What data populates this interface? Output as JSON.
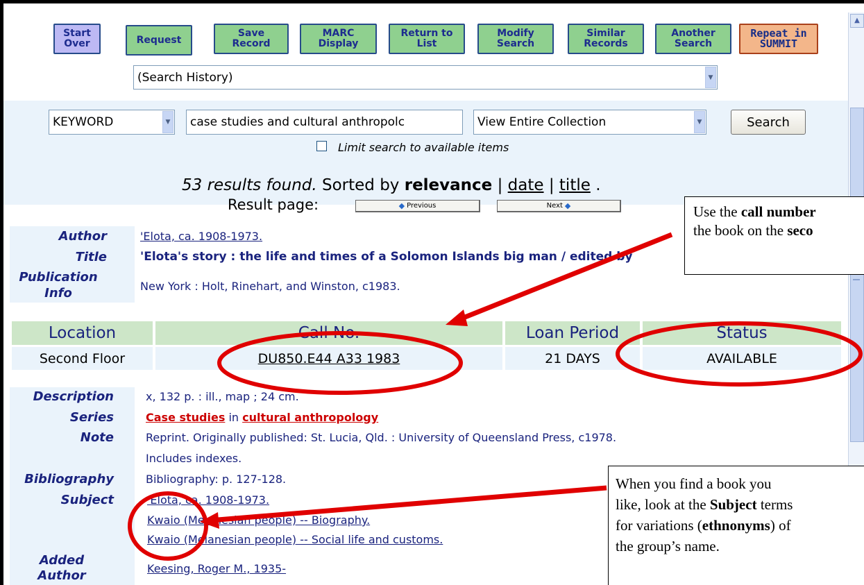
{
  "toolbar": {
    "start_over": "Start\nOver",
    "request": "Request",
    "save_record": "Save\nRecord",
    "marc_display": "MARC\nDisplay",
    "return_to_list": "Return to\nList",
    "modify_search": "Modify\nSearch",
    "similar_records": "Similar\nRecords",
    "another_search": "Another\nSearch",
    "repeat_summit": "Repeat in\nSUMMIT"
  },
  "history_select": {
    "value": "(Search History)"
  },
  "search": {
    "type": "KEYWORD",
    "query": "case studies and cultural anthropolc",
    "scope": "View Entire Collection",
    "button": "Search",
    "limit_label": "Limit search to available items"
  },
  "results": {
    "summary": "53 results found.",
    "sorted_by": "Sorted by",
    "relevance": "relevance",
    "sep1": "|",
    "date": "date",
    "sep2": "|",
    "title": "title",
    "end": ".",
    "page_label": "Result page:",
    "prev": "Previous",
    "next": "Next"
  },
  "record": {
    "author_label": "Author",
    "author": "'Elota, ca. 1908-1973.",
    "title_label": "Title",
    "title": "'Elota's story : the life and times of a Solomon Islands big man / edited by",
    "pub_label_1": "Publication",
    "pub_label_2": "Info",
    "pub": "New York : Holt, Rinehart, and Winston, c1983.",
    "holdings": {
      "headers": [
        "Location",
        "Call No.",
        "Loan Period",
        "Status"
      ],
      "location": "Second Floor",
      "call_no": "DU850.E44 A33 1983",
      "loan": "21 DAYS",
      "status": "AVAILABLE"
    },
    "description_label": "Description",
    "description": "x, 132 p. : ill., map ; 24 cm.",
    "series_label": "Series",
    "series_a": "Case studies",
    "series_in": " in ",
    "series_b": "cultural anthropology",
    "note_label": "Note",
    "note_1": "Reprint. Originally published: St. Lucia, Qld. : University of Queensland Press, c1978.",
    "note_2": "Includes indexes.",
    "bibliography_label": "Bibliography",
    "bibliography": "Bibliography: p. 127-128.",
    "subject_label": "Subject",
    "subject_1": "'Elota, ca. 1908-1973.",
    "subject_2": "Kwaio (Melanesian people) -- Biography.",
    "subject_3": "Kwaio (Melanesian people) -- Social life and customs.",
    "added_author_label_1": "Added",
    "added_author_label_2": "Author",
    "added_author": "Keesing, Roger M., 1935-"
  },
  "callouts": {
    "top_line1_a": "Use the ",
    "top_line1_b": "call number",
    "top_line2_a": "the book on the ",
    "top_line2_b": "seco",
    "bottom_line1": "When you find a book you",
    "bottom_line2_a": "like, look at the ",
    "bottom_line2_b": "Subject",
    "bottom_line2_c": " terms",
    "bottom_line3_a": "for variations (",
    "bottom_line3_b": "ethnonyms",
    "bottom_line3_c": ") of",
    "bottom_line4": "the group’s name."
  },
  "colors": {
    "accent_red": "#e00000",
    "button_green": "#8fd08f",
    "button_purple": "#bdb9f4",
    "button_orange": "#f3b68a",
    "link_navy": "#1a237e",
    "band_blue": "#eaf3fb",
    "table_green": "#cde6c8"
  }
}
